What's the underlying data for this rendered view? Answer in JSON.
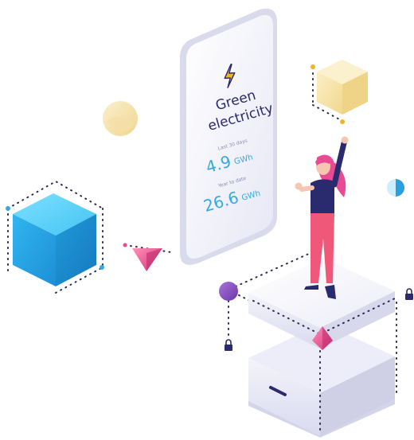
{
  "phone": {
    "icon": "lightning-bolt-icon",
    "title_line1": "Green",
    "title_line2": "electricity",
    "stat1": {
      "label": "Last 30 days",
      "value": "4.9",
      "unit": "GWh"
    },
    "stat2": {
      "label": "Year to date",
      "value": "26.6",
      "unit": "GWh"
    }
  },
  "colors": {
    "accent_blue": "#35a9e0",
    "pink": "#e94a93",
    "purple": "#8a4fc0",
    "navy": "#2a2a6e",
    "cream": "#f7e6b0"
  },
  "icons": [
    "lightning-bolt-icon",
    "lock-icon",
    "lock-icon"
  ]
}
